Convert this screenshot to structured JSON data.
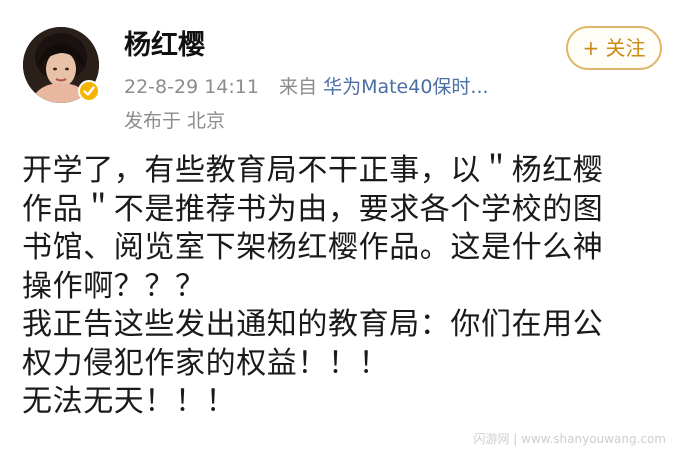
{
  "user": {
    "name": "杨红樱",
    "avatar_icon": "avatar",
    "verified_icon": "verified-badge-icon"
  },
  "meta": {
    "timestamp": "22-8-29 14:11",
    "source_prefix": "来自",
    "device": "华为Mate40保时...",
    "location": "发布于 北京"
  },
  "actions": {
    "follow_label": "+ 关注"
  },
  "post": {
    "lines": [
      "开学了，有些教育局不干正事，以＂杨红樱",
      "作品＂不是推荐书为由，要求各个学校的图",
      "书馆、阅览室下架杨红樱作品。这是什么神",
      "操作啊？？？",
      "我正告这些发出通知的教育局：你们在用公",
      "权力侵犯作家的权益！！！",
      "无法无天！！！"
    ]
  },
  "watermark": "闪游网 | www.shanyouwang.com",
  "colors": {
    "follow_accent": "#c98a16",
    "link_blue": "#4a6fa5",
    "muted_gray": "#8c8c8c"
  }
}
